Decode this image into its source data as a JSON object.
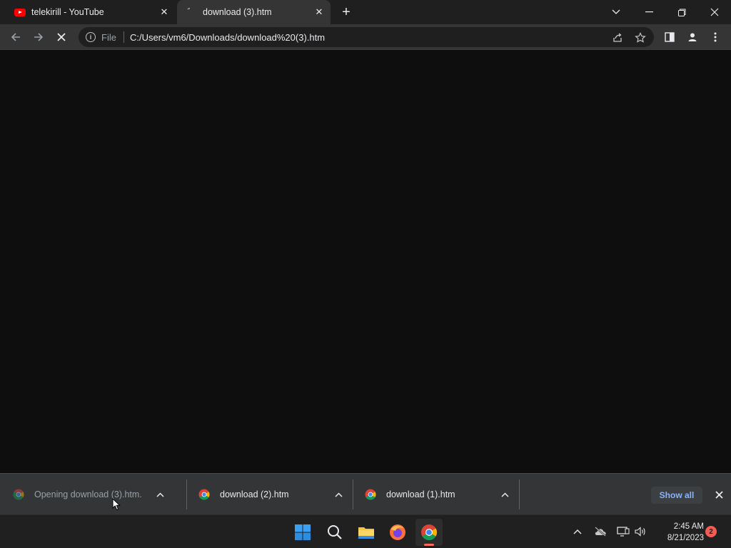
{
  "browser": {
    "tabs": [
      {
        "title": "telekirill - YouTube",
        "favicon": "youtube-icon"
      },
      {
        "title": "download (3).htm",
        "favicon": "loading-icon",
        "active": true
      }
    ],
    "omnibox": {
      "scheme_label": "File",
      "url": "C:/Users/vm6/Downloads/download%20(3).htm"
    }
  },
  "downloads": {
    "items": [
      {
        "label": "Opening download (3).htm...",
        "state": "opening"
      },
      {
        "label": "download (2).htm",
        "state": "complete"
      },
      {
        "label": "download (1).htm",
        "state": "complete"
      }
    ],
    "show_all_label": "Show all"
  },
  "taskbar": {
    "apps": [
      "windows-start-icon",
      "search-icon",
      "file-explorer-icon",
      "firefox-icon",
      "chrome-icon"
    ],
    "clock_time": "2:45 AM",
    "clock_date": "8/21/2023",
    "notification_count": "2"
  },
  "colors": {
    "accent_link": "#8ab4f8",
    "youtube_red": "#ff0000",
    "badge": "#f25c54"
  }
}
